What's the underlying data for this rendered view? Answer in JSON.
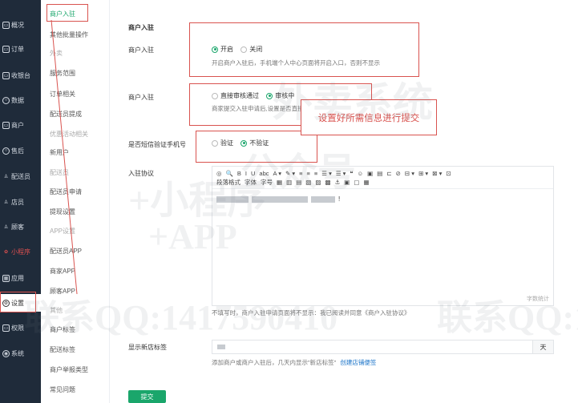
{
  "nav": [
    {
      "label": "概况",
      "icon": "overview-icon"
    },
    {
      "label": "订单",
      "icon": "orders-icon"
    },
    {
      "label": "收银台",
      "icon": "cashier-icon"
    },
    {
      "label": "数据",
      "icon": "data-icon"
    },
    {
      "label": "商户",
      "icon": "merchant-icon"
    },
    {
      "label": "售后",
      "icon": "after-sales-icon"
    },
    {
      "label": "配送员",
      "icon": "courier-icon"
    },
    {
      "label": "店员",
      "icon": "clerk-icon"
    },
    {
      "label": "顾客",
      "icon": "customer-icon"
    },
    {
      "label": "小程序",
      "icon": "mini-program-icon"
    },
    {
      "label": "应用",
      "icon": "apps-icon"
    },
    {
      "label": "设置",
      "icon": "settings-icon"
    },
    {
      "label": "权限",
      "icon": "permission-icon"
    },
    {
      "label": "系统",
      "icon": "system-icon"
    }
  ],
  "submenu": [
    {
      "label": "商户入驻"
    },
    {
      "label": "其他批量操作"
    },
    {
      "label": "外卖"
    },
    {
      "label": "服务范围"
    },
    {
      "label": "订单相关"
    },
    {
      "label": "配送员提成"
    },
    {
      "label": "优惠活动相关"
    },
    {
      "label": "新用户"
    },
    {
      "label": "配送员"
    },
    {
      "label": "配送员申请"
    },
    {
      "label": "提现设置"
    },
    {
      "label": "APP设置"
    },
    {
      "label": "配送员APP"
    },
    {
      "label": "商家APP"
    },
    {
      "label": "顾客APP"
    },
    {
      "label": "其他"
    },
    {
      "label": "商户标签"
    },
    {
      "label": "配送标签"
    },
    {
      "label": "商户举报类型"
    },
    {
      "label": "常见问题"
    }
  ],
  "form": {
    "section_title": "商户入驻",
    "enable_label": "商户入驻",
    "enable_on": "开启",
    "enable_off": "关闭",
    "enable_hint": "开启商户入驻后，手机端个人中心页面将开启入口，否则不显示",
    "review_label": "商户入驻",
    "review_pass": "直接审核通过",
    "review_pending": "审核中",
    "review_hint": "商家提交入驻申请后,设置是否直接审核通过.",
    "sms_label": "是否短信验证手机号",
    "sms_yes": "验证",
    "sms_no": "不验证",
    "agreement_label": "入驻协议",
    "agreement_hint": "不填写时，商户入驻申请页面将不显示：我已阅读并同意《商户入驻协议》",
    "word_count": "字数统计",
    "new_tag_label": "显示新店标签",
    "new_tag_suffix": "天",
    "new_tag_hint": "添加商户或商户入驻后，几天内显示\"新店标签\"",
    "new_tag_link": "创建店铺便签",
    "submit": "提交"
  },
  "editor": {
    "toolbar_row1": [
      "◎",
      "🔍",
      "B",
      "I",
      "U",
      "abc",
      "A ▾",
      "✎ ▾",
      "≡",
      "≡",
      "≡",
      "☰ ▾",
      "☰ ▾",
      "❝",
      "☺",
      "▣",
      "▤",
      "⊏",
      "⊘",
      "⊟ ▾",
      "⊞ ▾",
      "⊠ ▾",
      "⊡"
    ],
    "toolbar_row2": [
      "段落格式",
      "字体",
      "字号",
      "▦",
      "▥",
      "▤",
      "▧",
      "▨",
      "▩",
      "⚓",
      "▣",
      "▢",
      "▦"
    ]
  },
  "callout": "设置好所需信息进行提交",
  "watermark": {
    "line1": "外卖系统",
    "line2": "公众号",
    "line3": "+小程序",
    "line4": "+APP",
    "line5": "联系QQ:1417590410",
    "line6": "联系QQ:1"
  },
  "colors": {
    "accent": "#1aa66b",
    "nav_bg": "#1f2b3a",
    "annotation": "#d9534f"
  }
}
